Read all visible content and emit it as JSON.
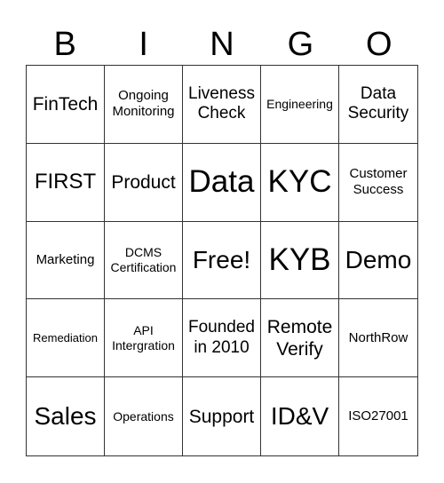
{
  "header": [
    "B",
    "I",
    "N",
    "G",
    "O"
  ],
  "cells": [
    "FinTech",
    "Ongoing Monitoring",
    "Liveness Check",
    "Engineering",
    "Data Security",
    "FIRST",
    "Product",
    "Data",
    "KYC",
    "Customer Success",
    "Marketing",
    "DCMS Certification",
    "Free!",
    "KYB",
    "Demo",
    "Remediation",
    "API Intergration",
    "Founded in 2010",
    "Remote Verify",
    "NorthRow",
    "Sales",
    "Operations",
    "Support",
    "ID&V",
    "ISO27001"
  ]
}
